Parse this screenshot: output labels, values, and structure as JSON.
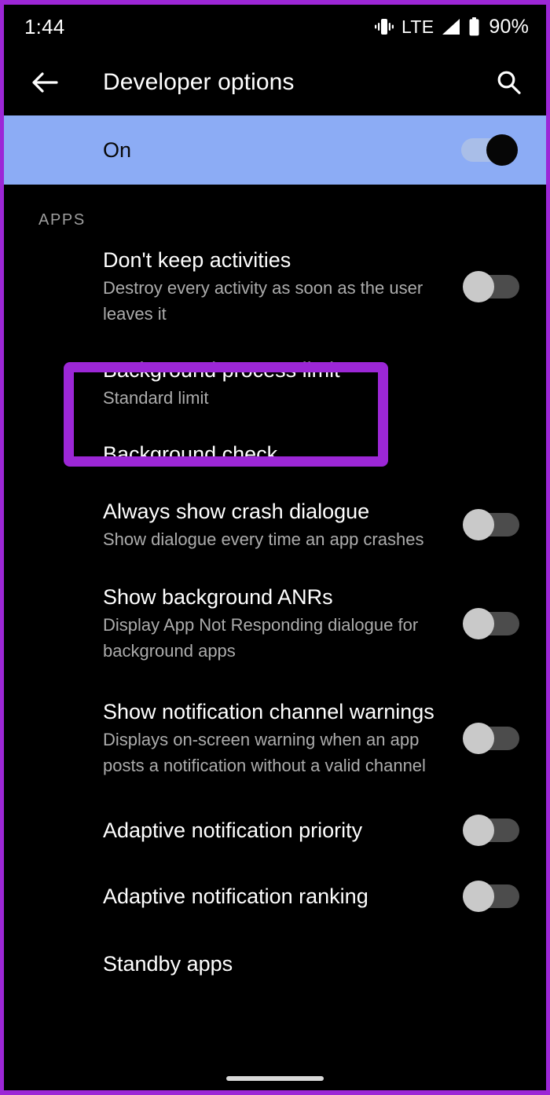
{
  "theme": {
    "accent_highlight": "#9C27D6",
    "banner_bg": "#8CACF5",
    "page_bg": "#000000",
    "title_color": "#FFFFFF",
    "summary_color": "#ACACAC"
  },
  "status_bar": {
    "clock": "1:44",
    "vibrate_icon": "vibrate-icon",
    "network_label": "LTE",
    "signal_icon": "signal-bars-icon",
    "battery_icon": "battery-icon",
    "battery_percent": "90%"
  },
  "app_bar": {
    "back_icon": "back-arrow-icon",
    "title": "Developer options",
    "search_icon": "search-icon"
  },
  "master_switch": {
    "label": "On",
    "state": "on"
  },
  "sections": [
    {
      "header": "APPS",
      "items": [
        {
          "title": "Don't keep activities",
          "summary": "Destroy every activity as soon as the user leaves it",
          "control": "switch",
          "state": "off"
        },
        {
          "title": "Background process limit",
          "summary": "Standard limit",
          "control": "none",
          "highlighted": true
        },
        {
          "title": "Background check",
          "summary": "",
          "control": "none"
        },
        {
          "title": "Always show crash dialogue",
          "summary": "Show dialogue every time an app crashes",
          "control": "switch",
          "state": "off"
        },
        {
          "title": "Show background ANRs",
          "summary": "Display App Not Responding dialogue for background apps",
          "control": "switch",
          "state": "off"
        },
        {
          "title": "Show notification channel warnings",
          "summary": "Displays on-screen warning when an app posts a notification without a valid channel",
          "control": "switch",
          "state": "off"
        },
        {
          "title": "Adaptive notification priority",
          "summary": "",
          "control": "switch",
          "state": "off"
        },
        {
          "title": "Adaptive notification ranking",
          "summary": "",
          "control": "switch",
          "state": "off"
        },
        {
          "title": "Standby apps",
          "summary": "",
          "control": "none"
        }
      ]
    }
  ],
  "nav": {
    "home_indicator": "home-indicator"
  }
}
